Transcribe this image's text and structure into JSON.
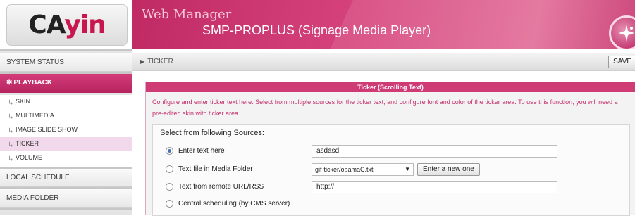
{
  "logo": {
    "text_main": "CA",
    "text_accent": "yin"
  },
  "header": {
    "app": "Web Manager",
    "product": "SMP-PROPLUS (Signage Media Player)"
  },
  "sidebar": {
    "system_status": "SYSTEM STATUS",
    "playback": "PLAYBACK",
    "playback_items": [
      "SKIN",
      "MULTIMEDIA",
      "IMAGE SLIDE SHOW",
      "TICKER",
      "VOLUME"
    ],
    "local_schedule": "LOCAL SCHEDULE",
    "media_folder": "MEDIA FOLDER"
  },
  "breadcrumb": {
    "current": "TICKER",
    "save_label": "SAVE"
  },
  "panel": {
    "title": "Ticker (Scrolling Text)",
    "description": "Configure and enter ticker text here. Select from multiple sources for the ticker text, and configure font and color of the ticker area. To use this function, you will need a pre-edited skin with ticker area.",
    "sources_label": "Select from following Sources:",
    "options": {
      "enter_text": {
        "label": "Enter text here",
        "value": "asdasd",
        "selected": true
      },
      "text_file": {
        "label": "Text file in Media Folder",
        "selected_file": "gif-ticker/obamaC.txt",
        "new_button": "Enter a new one"
      },
      "remote_url": {
        "label": "Text from remote URL/RSS",
        "value": "http://"
      },
      "central": {
        "label": "Central scheduling (by CMS server)"
      }
    }
  },
  "colors": {
    "brand": "#c8174e",
    "header_pink": "#d6437c",
    "active_item": "#f1d8ea"
  }
}
